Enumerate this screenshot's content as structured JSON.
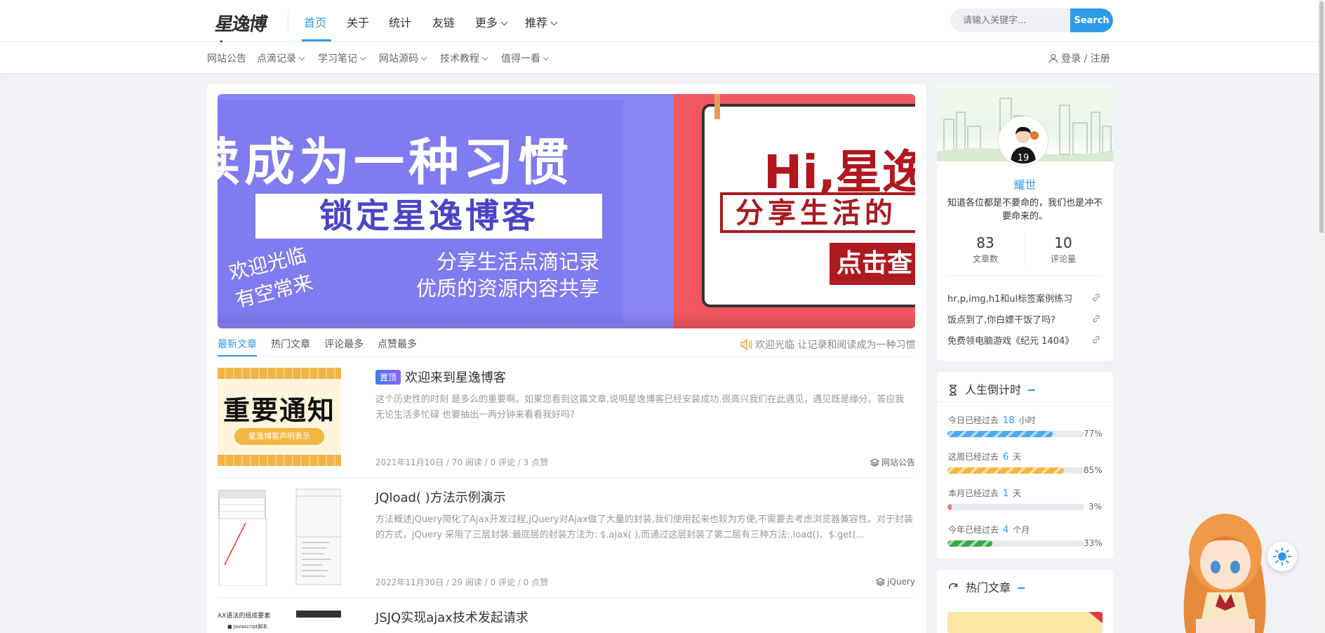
{
  "header": {
    "logo_text": "星逸博客",
    "nav": [
      {
        "label": "首页",
        "active": true
      },
      {
        "label": "关于"
      },
      {
        "label": "统计"
      },
      {
        "label": "友链"
      },
      {
        "label": "更多",
        "dropdown": true
      },
      {
        "label": "推荐",
        "dropdown": true
      }
    ],
    "search": {
      "placeholder": "请输入关键字...",
      "button": "Search"
    }
  },
  "subnav": {
    "items": [
      "网站公告",
      "点滴记录",
      "学习笔记",
      "网站源码",
      "技术教程",
      "值得一看"
    ],
    "login": "登录",
    "sep": "/",
    "register": "注册"
  },
  "slider": {
    "slide1": {
      "headline": "读成为一种习惯",
      "box": "锁定星逸博客",
      "left": "欢迎光临\n有空常来",
      "right1": "分享生活点滴记录",
      "right2": "优质的资源内容共享"
    },
    "slide2": {
      "headline": "Hi,星逸",
      "box": "分享生活的",
      "button": "点击查"
    }
  },
  "tabs": [
    "最新文章",
    "热门文章",
    "评论最多",
    "点赞最多"
  ],
  "notice": "欢迎光临 让记录和阅读成为一种习惯",
  "posts": [
    {
      "pinned": "置顶",
      "title": "欢迎来到星逸博客",
      "excerpt": "这个历史性的时刻 是多么的重要啊。如果您看到这篇文章,说明星逸博客已经安装成功.很高兴我们在此遇见，遇见既是缘分。答应我 无论生活多忙碌 也要抽出一两分钟来看看我好吗?",
      "date": "2021年11月10日",
      "reads": "70 阅读",
      "comments": "0 评论",
      "likes": "3 点赞",
      "category": "网站公告",
      "thumb_title": "重要通知",
      "thumb_tag": "星逸博客声明表示"
    },
    {
      "title": "JQload( )方法示例演示",
      "excerpt": "方法概述jQuery简化了Ajax开发过程,jQuery对Ajax做了大量的封装,我们使用起来也较为方便,不需要去考虑浏览器兼容性。对于封装的方式，jQuery 采用了三层封装:最底层的封装方法为: $.ajax( ),而通过这层封装了第二层有三种方法:.load()、$.get(...",
      "date": "2022年11月30日",
      "reads": "29 阅读",
      "comments": "0 评论",
      "likes": "0 点赞",
      "category": "jQuery"
    },
    {
      "title": "JSJQ实现ajax技术发起请求",
      "thumb_title": "AX语法的组成要素",
      "thumb_item": "Javascript脚本"
    }
  ],
  "profile": {
    "name": "耀世",
    "bio": "知道各位都是不要命的，我们也是冲不要命来的。",
    "stats": [
      {
        "value": "83",
        "label": "文章数"
      },
      {
        "value": "10",
        "label": "评论量"
      }
    ],
    "jersey": "19",
    "links": [
      "hr,p,img,h1和ul标签案例练习",
      "饭点到了,你白嫖干饭了吗?",
      "免费领电脑游戏《纪元 1404》"
    ]
  },
  "countdown": {
    "title": "人生倒计时",
    "rows": [
      {
        "prefix": "今日已经过去",
        "value": "18",
        "unit": "小时",
        "percent": 77,
        "percent_text": "77%",
        "color": "#4aaaf0"
      },
      {
        "prefix": "这周已经过去",
        "value": "6",
        "unit": "天",
        "percent": 85,
        "percent_text": "85%",
        "color": "#f5b73b"
      },
      {
        "prefix": "本月已经过去",
        "value": "1",
        "unit": "天",
        "percent": 3,
        "percent_text": "3%",
        "color": "#f07a7a"
      },
      {
        "prefix": "今年已经过去",
        "value": "4",
        "unit": "个月",
        "percent": 33,
        "percent_text": "33%",
        "color": "#3aa847"
      }
    ]
  },
  "hot": {
    "title": "热门文章"
  }
}
